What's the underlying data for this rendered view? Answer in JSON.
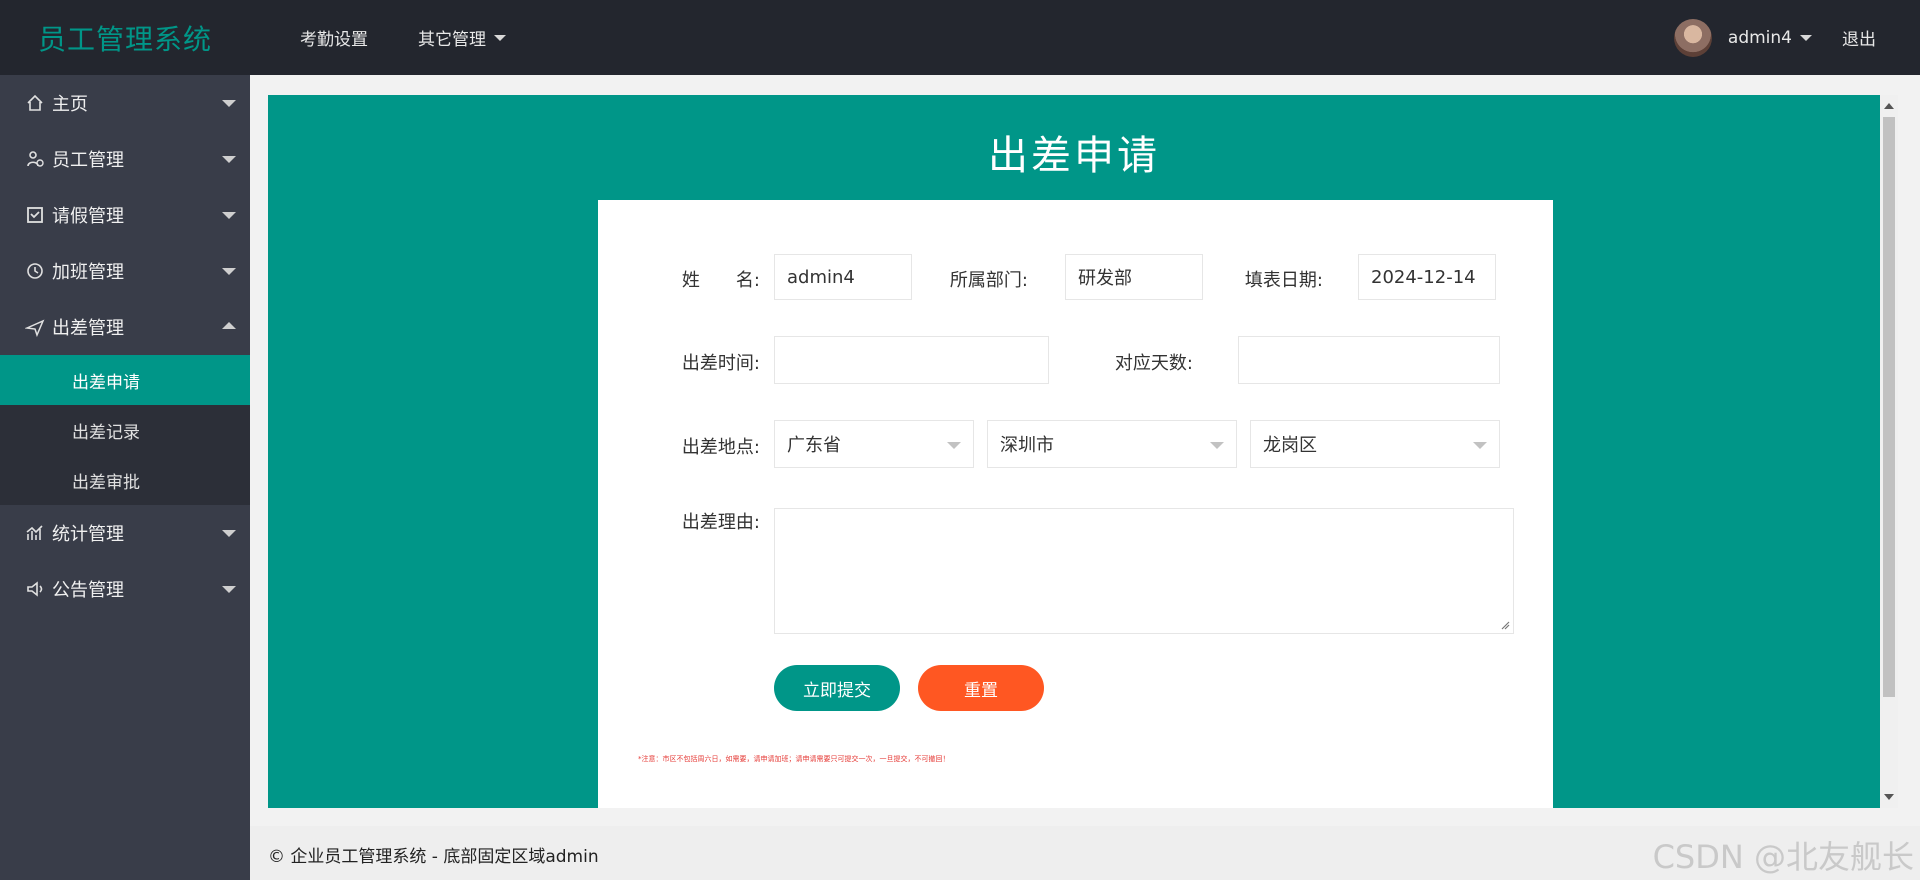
{
  "header": {
    "logo": "员工管理系统",
    "nav": [
      {
        "label": "考勤设置"
      },
      {
        "label": "其它管理"
      }
    ],
    "user": "admin4",
    "logout": "退出"
  },
  "sidebar": {
    "items": [
      {
        "label": "主页",
        "icon": "home-icon"
      },
      {
        "label": "员工管理",
        "icon": "staff-icon"
      },
      {
        "label": "请假管理",
        "icon": "leave-icon"
      },
      {
        "label": "加班管理",
        "icon": "overtime-icon"
      },
      {
        "label": "出差管理",
        "icon": "plane-icon",
        "expanded": true
      },
      {
        "label": "统计管理",
        "icon": "chart-icon"
      },
      {
        "label": "公告管理",
        "icon": "announce-icon"
      }
    ],
    "sub_items": [
      {
        "label": "出差申请",
        "active": true
      },
      {
        "label": "出差记录"
      },
      {
        "label": "出差审批"
      }
    ]
  },
  "page": {
    "title": "出差申请"
  },
  "form": {
    "name_label": "姓　　名:",
    "name_value": "admin4",
    "dept_label": "所属部门:",
    "dept_value": "研发部",
    "date_label": "填表日期:",
    "date_value": "2024-12-14",
    "time_label": "出差时间:",
    "time_value": "",
    "days_label": "对应天数:",
    "days_value": "",
    "place_label": "出差地点:",
    "province": "广东省",
    "city": "深圳市",
    "district": "龙岗区",
    "reason_label": "出差理由:",
    "reason_value": "",
    "submit": "立即提交",
    "reset": "重置",
    "note": "*注意：市区不包括周六日，如需要，请申请加班；请申请需要只可提交一次，一旦提交，不可撤回！"
  },
  "footer": {
    "text": "© 企业员工管理系统 - 底部固定区域admin",
    "watermark": "CSDN @北友舰长"
  },
  "colors": {
    "primary": "#009688",
    "danger": "#ff5722",
    "header_bg": "#23262e",
    "sidebar_bg": "#393d49"
  }
}
